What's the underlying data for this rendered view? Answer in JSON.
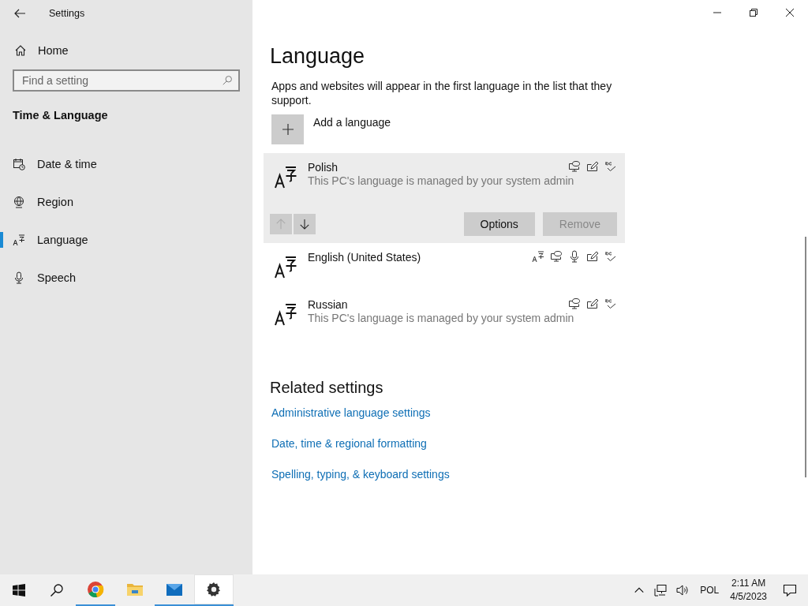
{
  "window": {
    "title": "Settings"
  },
  "sidebar": {
    "home": "Home",
    "search": {
      "placeholder": "Find a setting"
    },
    "section": "Time & Language",
    "items": [
      {
        "label": "Date & time",
        "kind": "calendar",
        "selected": false
      },
      {
        "label": "Region",
        "kind": "globe",
        "selected": false
      },
      {
        "label": "Language",
        "kind": "language",
        "selected": true
      },
      {
        "label": "Speech",
        "kind": "microphone",
        "selected": false
      }
    ]
  },
  "page": {
    "title": "Language",
    "description": "Apps and websites will appear in the first language in the list that they support.",
    "add_language": "Add a language",
    "languages": [
      {
        "name": "Polish",
        "note": "This PC's language is managed by your system admin",
        "selected": true,
        "features": [
          {
            "kind": "display"
          },
          {
            "kind": "handwriting"
          },
          {
            "kind": "spelling"
          }
        ],
        "move_up_disabled": true,
        "options": "Options",
        "remove": "Remove",
        "remove_disabled": true
      },
      {
        "name": "English (United States)",
        "selected": false,
        "features": [
          {
            "kind": "language-pack"
          },
          {
            "kind": "display"
          },
          {
            "kind": "speech"
          },
          {
            "kind": "handwriting"
          },
          {
            "kind": "spelling"
          }
        ]
      },
      {
        "name": "Russian",
        "note": "This PC's language is managed by your system admin",
        "selected": false,
        "features": [
          {
            "kind": "display"
          },
          {
            "kind": "handwriting"
          },
          {
            "kind": "spelling"
          }
        ]
      }
    ],
    "related_title": "Related settings",
    "related_links": [
      "Administrative language settings",
      "Date, time & regional formatting",
      "Spelling, typing, & keyboard settings"
    ]
  },
  "taskbar": {
    "apps": [
      {
        "kind": "chrome",
        "running": true,
        "selected": false
      },
      {
        "kind": "explorer",
        "running": false,
        "selected": false
      },
      {
        "kind": "mail",
        "running": true,
        "selected": false
      },
      {
        "kind": "settings",
        "running": true,
        "selected": true
      }
    ],
    "keyboard": "POL",
    "time": "2:11 AM",
    "date": "4/5/2023"
  }
}
